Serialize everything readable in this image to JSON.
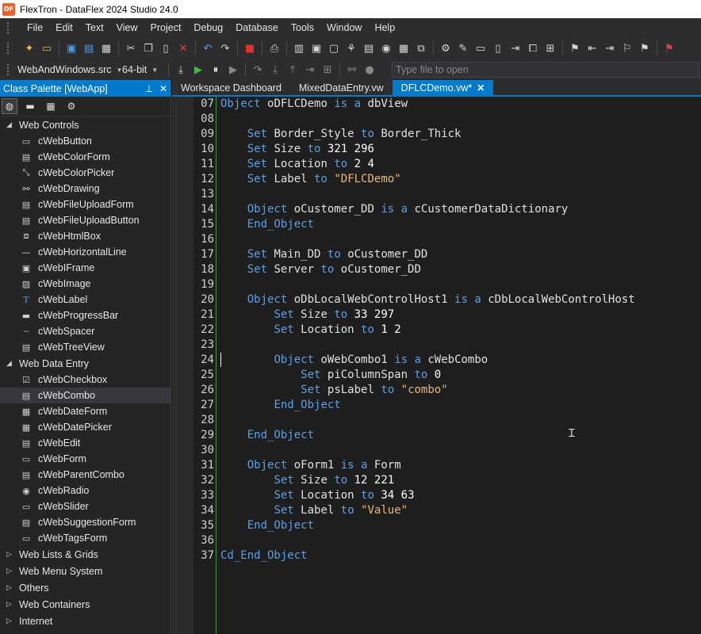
{
  "window": {
    "title": "FlexTron - DataFlex 2024 Studio 24.0",
    "logo": "DF"
  },
  "menu": [
    "File",
    "Edit",
    "Text",
    "View",
    "Project",
    "Debug",
    "Database",
    "Tools",
    "Window",
    "Help"
  ],
  "toolbar2": {
    "project_combo": "WebAndWindows.src",
    "platform_combo": "64-bit",
    "file_open_placeholder": "Type file to open"
  },
  "palette": {
    "title": "Class Palette [WebApp]",
    "categories": [
      {
        "name": "Web Controls",
        "expanded": true,
        "items": [
          {
            "label": "cWebButton",
            "icon": "button-icon"
          },
          {
            "label": "cWebColorForm",
            "icon": "color-form-icon"
          },
          {
            "label": "cWebColorPicker",
            "icon": "color-picker-icon"
          },
          {
            "label": "cWebDrawing",
            "icon": "drawing-icon"
          },
          {
            "label": "cWebFileUploadForm",
            "icon": "upload-form-icon"
          },
          {
            "label": "cWebFileUploadButton",
            "icon": "upload-button-icon"
          },
          {
            "label": "cWebHtmlBox",
            "icon": "html-box-icon"
          },
          {
            "label": "cWebHorizontalLine",
            "icon": "horizontal-line-icon"
          },
          {
            "label": "cWebIFrame",
            "icon": "iframe-icon"
          },
          {
            "label": "cWebImage",
            "icon": "image-icon"
          },
          {
            "label": "cWebLabel",
            "icon": "label-icon"
          },
          {
            "label": "cWebProgressBar",
            "icon": "progress-bar-icon"
          },
          {
            "label": "cWebSpacer",
            "icon": "spacer-icon"
          },
          {
            "label": "cWebTreeView",
            "icon": "tree-view-icon"
          }
        ]
      },
      {
        "name": "Web Data Entry",
        "expanded": true,
        "items": [
          {
            "label": "cWebCheckbox",
            "icon": "checkbox-icon"
          },
          {
            "label": "cWebCombo",
            "icon": "combo-icon"
          },
          {
            "label": "cWebDateForm",
            "icon": "date-form-icon"
          },
          {
            "label": "cWebDatePicker",
            "icon": "date-picker-icon"
          },
          {
            "label": "cWebEdit",
            "icon": "edit-icon"
          },
          {
            "label": "cWebForm",
            "icon": "form-icon"
          },
          {
            "label": "cWebParentCombo",
            "icon": "parent-combo-icon"
          },
          {
            "label": "cWebRadio",
            "icon": "radio-icon"
          },
          {
            "label": "cWebSlider",
            "icon": "slider-icon"
          },
          {
            "label": "cWebSuggestionForm",
            "icon": "suggestion-form-icon"
          },
          {
            "label": "cWebTagsForm",
            "icon": "tags-form-icon"
          }
        ]
      },
      {
        "name": "Web Lists & Grids",
        "expanded": false,
        "items": []
      },
      {
        "name": "Web Menu System",
        "expanded": false,
        "items": []
      },
      {
        "name": "Others",
        "expanded": false,
        "items": []
      },
      {
        "name": "Web Containers",
        "expanded": false,
        "items": []
      },
      {
        "name": "Internet",
        "expanded": false,
        "items": []
      }
    ],
    "selected_item": "cWebCombo"
  },
  "tabs": [
    {
      "label": "Workspace Dashboard",
      "active": false
    },
    {
      "label": "MixedDataEntry.vw",
      "active": false
    },
    {
      "label": "DFLCDemo.vw*",
      "active": true
    }
  ],
  "editor": {
    "lines": [
      {
        "num": "07",
        "text": "Object oDFLCDemo is a dbView"
      },
      {
        "num": "08",
        "text": ""
      },
      {
        "num": "09",
        "text": "    Set Border_Style to Border_Thick"
      },
      {
        "num": "10",
        "text": "    Set Size to 321 296"
      },
      {
        "num": "11",
        "text": "    Set Location to 2 4"
      },
      {
        "num": "12",
        "text": "    Set Label to \"DFLCDemo\""
      },
      {
        "num": "13",
        "text": ""
      },
      {
        "num": "14",
        "text": "    Object oCustomer_DD is a cCustomerDataDictionary"
      },
      {
        "num": "15",
        "text": "    End_Object"
      },
      {
        "num": "16",
        "text": ""
      },
      {
        "num": "17",
        "text": "    Set Main_DD to oCustomer_DD"
      },
      {
        "num": "18",
        "text": "    Set Server to oCustomer_DD"
      },
      {
        "num": "19",
        "text": ""
      },
      {
        "num": "20",
        "text": "    Object oDbLocalWebControlHost1 is a cDbLocalWebControlHost"
      },
      {
        "num": "21",
        "text": "        Set Size to 33 297"
      },
      {
        "num": "22",
        "text": "        Set Location to 1 2"
      },
      {
        "num": "23",
        "text": ""
      },
      {
        "num": "24",
        "text": "        Object oWebCombo1 is a cWebCombo"
      },
      {
        "num": "25",
        "text": "            Set piColumnSpan to 0"
      },
      {
        "num": "26",
        "text": "            Set psLabel to \"combo\""
      },
      {
        "num": "27",
        "text": "        End_Object"
      },
      {
        "num": "28",
        "text": ""
      },
      {
        "num": "29",
        "text": "    End_Object"
      },
      {
        "num": "30",
        "text": ""
      },
      {
        "num": "31",
        "text": "    Object oForm1 is a Form"
      },
      {
        "num": "32",
        "text": "        Set Size to 12 221"
      },
      {
        "num": "33",
        "text": "        Set Location to 34 63"
      },
      {
        "num": "34",
        "text": "        Set Label to \"Value\""
      },
      {
        "num": "35",
        "text": "    End_Object"
      },
      {
        "num": "36",
        "text": ""
      },
      {
        "num": "37",
        "text": "Cd_End_Object"
      }
    ]
  },
  "colors": {
    "accent": "#007acc",
    "keyword": "#5ba0e6",
    "string": "#e8b878"
  }
}
